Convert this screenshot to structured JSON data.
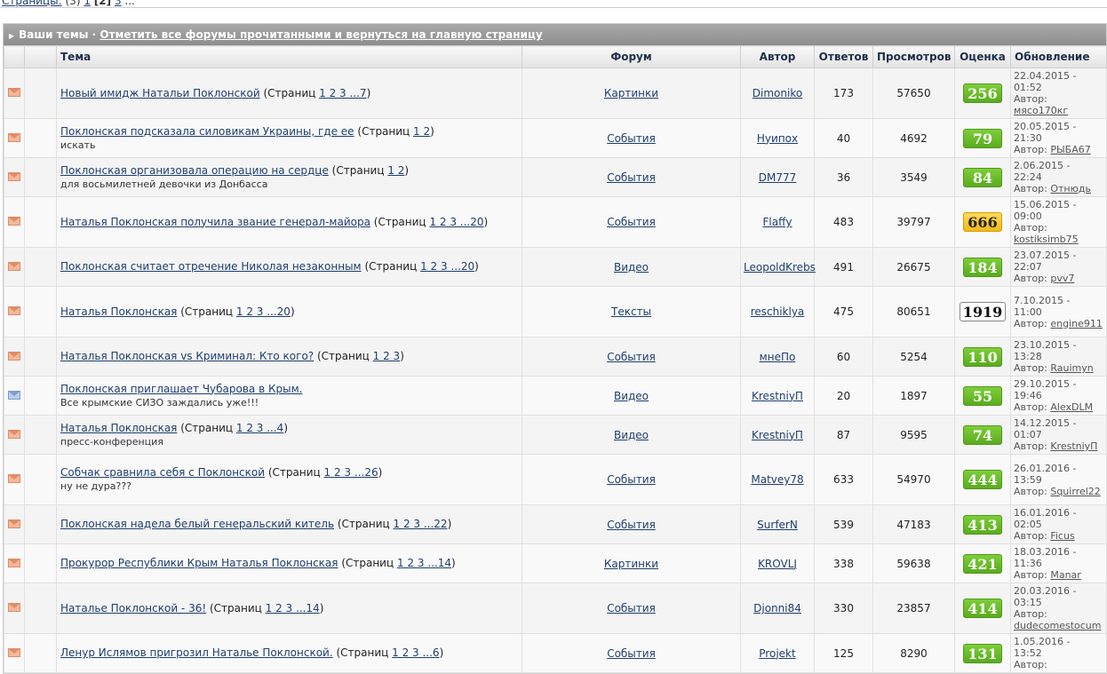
{
  "pager": {
    "label": "Страницы:",
    "count": "(3)",
    "page1": "1",
    "current": "[2]",
    "page3": "3",
    "ellipsis": "..."
  },
  "header": {
    "title": "Ваши темы",
    "separator": " · ",
    "mark_read_link": "Отметить все форумы прочитанными и вернуться на главную страницу"
  },
  "columns": {
    "topic": "Тема",
    "forum": "Форум",
    "author": "Автор",
    "replies": "Ответов",
    "views": "Просмотров",
    "rating": "Оценка",
    "updated": "Обновление"
  },
  "labels": {
    "pages_open": "(Страниц ",
    "pages_close": ")",
    "author_prefix": "Автор: "
  },
  "colors": {
    "rating_green": "#5aab1f",
    "rating_yellow": "#f3b91a",
    "link": "#1f3f6e",
    "title_bar": "#9a9a9a"
  },
  "rows": [
    {
      "icon": "envelope-icon",
      "title": "Новый имидж Натальи Поклонской",
      "pages": "1 2 3 ...7",
      "desc": "",
      "forum": "Картинки",
      "author": "Dimoniko",
      "replies": "173",
      "views": "57650",
      "rating": "256",
      "rating_style": "green",
      "upd_date": "22.04.2015 -",
      "upd_time": "01:52",
      "upd_author": "мясо170кг"
    },
    {
      "icon": "envelope-icon",
      "title": "Поклонская подсказала силовикам Украины, где ее",
      "pages": "1 2",
      "desc": "искать",
      "forum": "События",
      "author": "Нуипох",
      "replies": "40",
      "views": "4692",
      "rating": "79",
      "rating_style": "green",
      "upd_date": "20.05.2015 -",
      "upd_time": "21:30",
      "upd_author": "РЫБА67"
    },
    {
      "icon": "envelope-icon",
      "title": "Поклонская организовала операцию на сердце",
      "pages": "1 2",
      "desc": "для восьмилетней девочки из Донбасса",
      "forum": "События",
      "author": "DM777",
      "replies": "36",
      "views": "3549",
      "rating": "84",
      "rating_style": "green",
      "upd_date": "2.06.2015 -",
      "upd_time": "22:24",
      "upd_author": "Отнюдь"
    },
    {
      "icon": "envelope-icon",
      "title": "Наталья Поклонская получила звание генерал-майора",
      "pages": "1 2 3 ...20",
      "desc": "",
      "forum": "События",
      "author": "Flaffy",
      "replies": "483",
      "views": "39797",
      "rating": "666",
      "rating_style": "yellow",
      "upd_date": "15.06.2015 -",
      "upd_time": "09:00",
      "upd_author": "kostiksimb75"
    },
    {
      "icon": "envelope-icon",
      "title": "Поклонская считает отречение Николая незаконным",
      "pages": "1 2 3 ...20",
      "desc": "",
      "forum": "Видео",
      "author": "LeopoldKrebs",
      "replies": "491",
      "views": "26675",
      "rating": "184",
      "rating_style": "green",
      "upd_date": "23.07.2015 -",
      "upd_time": "22:07",
      "upd_author": "pvv7"
    },
    {
      "icon": "envelope-icon",
      "title": "Наталья Поклонская",
      "pages": "1 2 3 ...20",
      "desc": "",
      "forum": "Тексты",
      "author": "reschiklya",
      "replies": "475",
      "views": "80651",
      "rating": "1919",
      "rating_style": "white",
      "upd_date": "7.10.2015 -",
      "upd_time": "11:00",
      "upd_author": "engine911"
    },
    {
      "icon": "envelope-icon",
      "title": "Наталья Поклонская vs Криминал: Кто кого?",
      "pages": "1 2 3",
      "desc": "",
      "forum": "События",
      "author": "мнеПо",
      "replies": "60",
      "views": "5254",
      "rating": "110",
      "rating_style": "green",
      "upd_date": "23.10.2015 -",
      "upd_time": "13:28",
      "upd_author": "Rauimyn"
    },
    {
      "icon": "envelope-blue-icon",
      "title": "Поклонская приглашает Чубарова в Крым.",
      "pages": "",
      "desc": "Все крымские СИЗО заждались уже!!!",
      "forum": "Видео",
      "author": "KrestniyП",
      "replies": "20",
      "views": "1897",
      "rating": "55",
      "rating_style": "green",
      "upd_date": "29.10.2015 -",
      "upd_time": "19:46",
      "upd_author": "AlexDLM"
    },
    {
      "icon": "envelope-icon",
      "title": "Наталья Поклонская",
      "pages": "1 2 3 ...4",
      "desc": "пресс-конференция",
      "forum": "Видео",
      "author": "KrestniyП",
      "replies": "87",
      "views": "9595",
      "rating": "74",
      "rating_style": "green",
      "upd_date": "14.12.2015 -",
      "upd_time": "01:07",
      "upd_author": "KrestniyП"
    },
    {
      "icon": "envelope-icon",
      "title": "Собчак сравнила себя с Поклонской",
      "pages": "1 2 3 ...26",
      "desc": "ну не дура???",
      "forum": "События",
      "author": "Matvey78",
      "replies": "633",
      "views": "54970",
      "rating": "444",
      "rating_style": "green",
      "upd_date": "26.01.2016 -",
      "upd_time": "13:59",
      "upd_author": "Squirrel22"
    },
    {
      "icon": "envelope-icon",
      "title": "Поклонская надела белый генеральский китель",
      "pages": "1 2 3 ...22",
      "desc": "",
      "forum": "События",
      "author": "SurferN",
      "replies": "539",
      "views": "47183",
      "rating": "413",
      "rating_style": "green",
      "upd_date": "16.01.2016 -",
      "upd_time": "02:05",
      "upd_author": "Ficus"
    },
    {
      "icon": "envelope-icon",
      "title": "Прокурор Республики Крым Наталья Поклонская",
      "pages": "1 2 3 ...14",
      "desc": "",
      "forum": "Картинки",
      "author": "KROVLJ",
      "replies": "338",
      "views": "59638",
      "rating": "421",
      "rating_style": "green",
      "upd_date": "18.03.2016 -",
      "upd_time": "11:36",
      "upd_author": "Manar"
    },
    {
      "icon": "envelope-icon",
      "title": "Наталье Поклонской - 36!",
      "pages": "1 2 3 ...14",
      "desc": "",
      "forum": "События",
      "author": "Djonni84",
      "replies": "330",
      "views": "23857",
      "rating": "414",
      "rating_style": "green",
      "upd_date": "20.03.2016 -",
      "upd_time": "03:15",
      "upd_author": "dudecomestocum"
    },
    {
      "icon": "envelope-icon",
      "title": "Ленур Ислямов пригрозил Наталье Поклонской.",
      "pages": "1 2 3 ...6",
      "desc": "",
      "forum": "События",
      "author": "Projekt",
      "replies": "125",
      "views": "8290",
      "rating": "131",
      "rating_style": "green",
      "upd_date": "1.05.2016 -",
      "upd_time": "13:52",
      "upd_author": ""
    }
  ]
}
